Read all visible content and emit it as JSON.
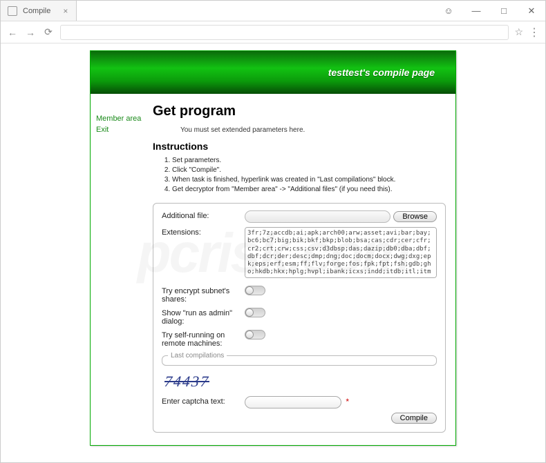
{
  "browser": {
    "tab_title": "Compile",
    "window_user_icon": "user",
    "window_min": "—",
    "window_max": "□",
    "window_close": "✕"
  },
  "banner": {
    "title": "testtest's compile page"
  },
  "sidebar": {
    "items": [
      {
        "label": "Member area"
      },
      {
        "label": "Exit"
      }
    ]
  },
  "main": {
    "heading": "Get program",
    "hint": "You must set extended parameters here.",
    "instructions_heading": "Instructions",
    "instructions": [
      "Set parameters.",
      "Click \"Compile\".",
      "When task is finished, hyperlink was created in \"Last compilations\" block.",
      "Get decryptor from \"Member area\" -> \"Additional files\" (if you need this)."
    ],
    "form": {
      "additional_file_label": "Additional file:",
      "browse_label": "Browse",
      "extensions_label": "Extensions:",
      "extensions_value": "3fr;7z;accdb;ai;apk;arch00;arw;asset;avi;bar;bay;bc6;bc7;big;bik;bkf;bkp;blob;bsa;cas;cdr;cer;cfr;cr2;crt;crw;css;csv;d3dbsp;das;dazip;db0;dba;dbf;dbf;dcr;der;desc;dmp;dng;doc;docm;docx;dwg;dxg;epk;eps;erf;esm;ff;flv;forge;fos;fpk;fpt;fsh;gdb;gho;hkdb;hkx;hplg;hvpl;ibank;icxs;indd;itdb;itl;itm",
      "toggle1_label": "Try encrypt subnet's shares:",
      "toggle2_label": "Show \"run as admin\" dialog:",
      "toggle3_label": "Try self-running on remote machines:",
      "last_compilations_legend": "Last compilations",
      "captcha_image_text": "74437",
      "captcha_label": "Enter captcha text:",
      "captcha_value": "",
      "compile_label": "Compile"
    }
  },
  "watermark": "pcrisk.com"
}
